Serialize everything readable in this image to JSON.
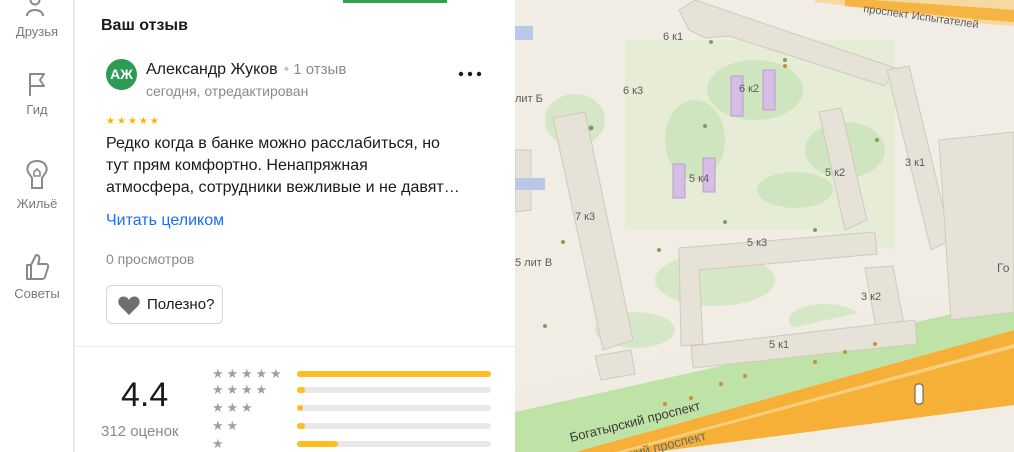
{
  "sidebar": {
    "items": [
      {
        "label": "Друзья",
        "icon": "friends-icon"
      },
      {
        "label": "Гид",
        "icon": "flag-icon"
      },
      {
        "label": "Жильё",
        "icon": "house-icon"
      },
      {
        "label": "Советы",
        "icon": "thumbs-up-icon"
      }
    ]
  },
  "review": {
    "section_title": "Ваш отзыв",
    "avatar_initials": "АЖ",
    "author_name": "Александр Жуков",
    "author_reviews": "1 отзыв",
    "date": "сегодня, отредактирован",
    "stars": 5,
    "text_lines": [
      "Редко когда в банке можно расслабиться, но",
      "тут прям комфортно. Ненапряжная",
      "атмосфера, сотрудники вежливые и не давят…"
    ],
    "read_more_label": "Читать целиком",
    "views": "0 просмотров",
    "useful_label": "Полезно?"
  },
  "rating_summary": {
    "score": "4.4",
    "count_label": "312 оценок",
    "distribution": [
      {
        "stars": 5,
        "fraction": 1.0
      },
      {
        "stars": 4,
        "fraction": 0.04
      },
      {
        "stars": 3,
        "fraction": 0.02
      },
      {
        "stars": 2,
        "fraction": 0.04
      },
      {
        "stars": 1,
        "fraction": 0.21
      }
    ]
  },
  "map": {
    "labels": {
      "street_top": "проспект Испытателей",
      "street_bottom": "Богатырский проспект",
      "street_bottom2": "ский проспект",
      "b6k1": "6 к1",
      "b6k2": "6 к2",
      "b6k3": "6 к3",
      "lit_b": "лит Б",
      "b5k4": "5 к4",
      "b5k2": "5 к2",
      "b3k1": "3 к1",
      "b7k3": "7 к3",
      "b5k3": "5 к3",
      "lit_v": "5 лит В",
      "b3k2": "3 к2",
      "b5k1": "5 к1",
      "edge": "Го"
    }
  },
  "colors": {
    "accent_green": "#31a24c",
    "link_blue": "#196dff",
    "star_gold": "#ffbd24",
    "avatar_green": "#2e9b55",
    "road_orange": "#f6b037"
  }
}
